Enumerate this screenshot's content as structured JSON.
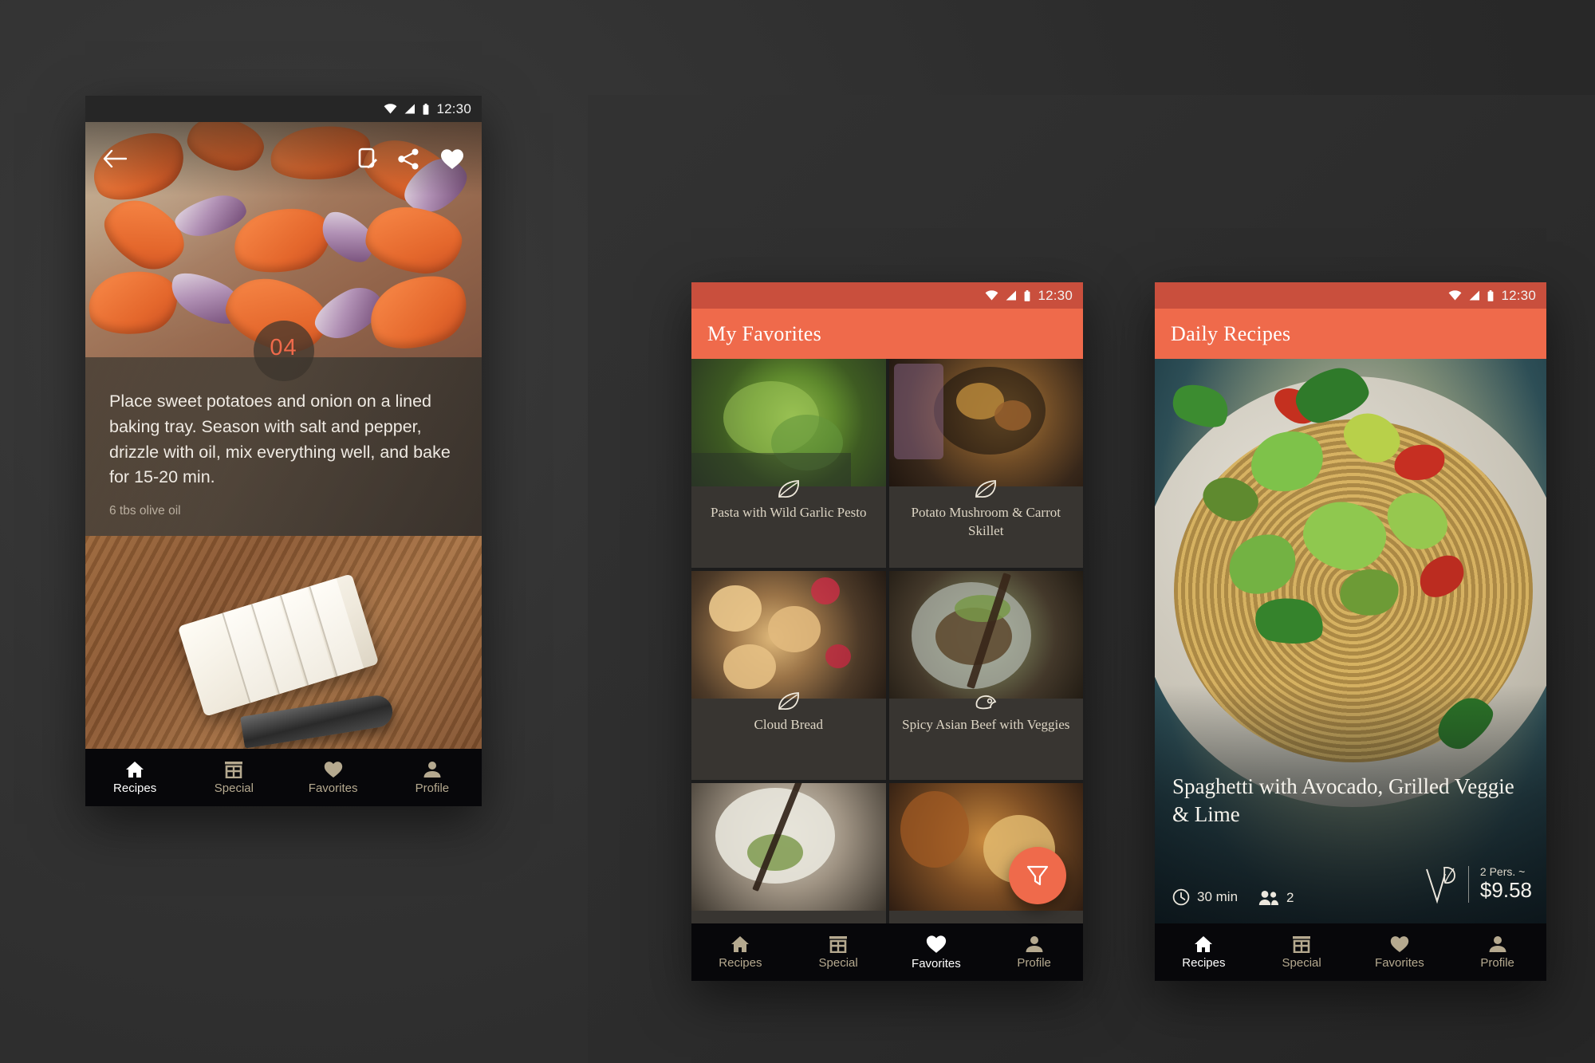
{
  "status_bar": {
    "time": "12:30",
    "icons": [
      "wifi-icon",
      "signal-icon",
      "battery-icon"
    ]
  },
  "colors": {
    "accent": "#ef6a4b",
    "accent_dark": "#c94f3d",
    "nav_bg": "#07070a",
    "nav_inactive": "#b5a98f",
    "nav_active": "#ffffff",
    "card_bg": "#383531",
    "caption": "#ddd5c4"
  },
  "bottom_nav": {
    "items": [
      {
        "label": "Recipes",
        "icon": "home-icon"
      },
      {
        "label": "Special",
        "icon": "store-icon"
      },
      {
        "label": "Favorites",
        "icon": "heart-icon"
      },
      {
        "label": "Profile",
        "icon": "person-icon"
      }
    ]
  },
  "screens": {
    "recipe_step": {
      "name": "Recipe Step Detail",
      "appbar_actions": [
        {
          "icon": "back-arrow-icon",
          "label": "Back"
        },
        {
          "icon": "note-edit-icon",
          "label": "Notes"
        },
        {
          "icon": "share-icon",
          "label": "Share"
        },
        {
          "icon": "heart-filled-icon",
          "label": "Favorite"
        }
      ],
      "step_number": "04",
      "step_text": "Place sweet potatoes and onion on a lined baking tray. Season with salt and pepper, drizzle with oil, mix everything well, and bake for 15-20 min.",
      "step_ingredient": "6 tbs olive oil",
      "active_nav": "Recipes",
      "top_photo_alt": "roasted sweet potato and red onion on tray",
      "bottom_photo_alt": "sliced white cheese on wooden board with knife"
    },
    "favorites": {
      "name": "My Favorites",
      "title": "My Favorites",
      "active_nav": "Favorites",
      "fab": {
        "icon": "filter-funnel-icon",
        "label": "Filter"
      },
      "cards": [
        {
          "title": "Pasta with Wild Garlic Pesto",
          "badge": "leaf-icon",
          "thumb": "th-pesto"
        },
        {
          "title": "Potato Mushroom & Carrot Skillet",
          "badge": "leaf-icon",
          "thumb": "th-skillet"
        },
        {
          "title": "Cloud Bread",
          "badge": "leaf-icon",
          "thumb": "th-cloud"
        },
        {
          "title": "Spicy Asian Beef with Veggies",
          "badge": "meat-cut-icon",
          "thumb": "th-beef"
        }
      ]
    },
    "daily_recipe": {
      "name": "Daily Recipes",
      "title": "Daily Recipes",
      "active_nav": "Recipes",
      "recipe_title": "Spaghetti with Avocado, Grilled Veggie & Lime",
      "meta": {
        "time_icon": "clock-icon",
        "time": "30 min",
        "servings_icon": "people-icon",
        "servings": "2",
        "diet_icon": "vegetarian-leaf-icon",
        "persons_note": "2 Pers. ~",
        "price": "$9.58"
      },
      "hero_photo_alt": "spaghetti with avocado, grilled veggies and lime on grey plate"
    }
  }
}
